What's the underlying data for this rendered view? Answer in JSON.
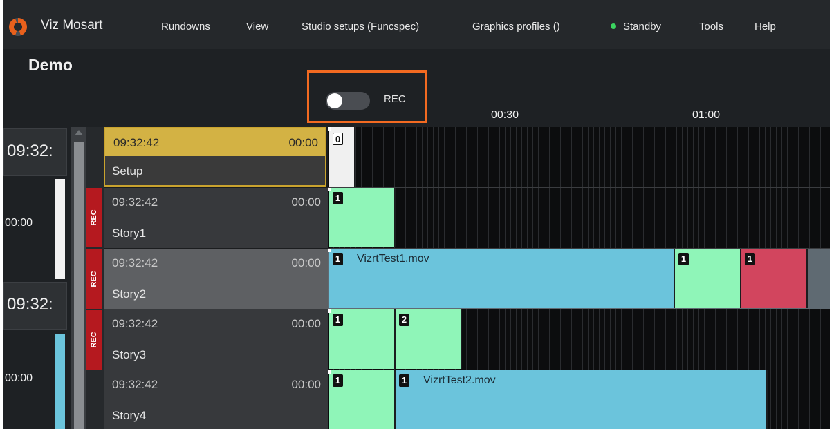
{
  "app": {
    "title": "Viz Mosart",
    "brand_color": "#e8601c",
    "menu": [
      {
        "label": "Rundowns"
      },
      {
        "label": "View"
      },
      {
        "label": "Studio setups (Funcspec)"
      },
      {
        "label": "Graphics profiles ()"
      },
      {
        "label": "Standby",
        "status_color": "#3bd45f"
      },
      {
        "label": "Tools"
      },
      {
        "label": "Help"
      }
    ]
  },
  "header": {
    "title": "Demo",
    "rec_toggle": {
      "label": "REC",
      "on": false,
      "highlight_color": "#f26a21"
    },
    "ticks": [
      "00:30",
      "01:00"
    ]
  },
  "left_column": {
    "clock_top": "09:32:",
    "dur_1": "00:00",
    "clock_mid": "09:32:",
    "dur_2": "00:00"
  },
  "rec_badge_label": "REC",
  "stories": [
    {
      "time": "09:32:42",
      "duration": "00:00",
      "name": "Setup",
      "rec": false,
      "state": "on-air"
    },
    {
      "time": "09:32:42",
      "duration": "00:00",
      "name": "Story1",
      "rec": true,
      "state": "normal"
    },
    {
      "time": "09:32:42",
      "duration": "00:00",
      "name": "Story2",
      "rec": true,
      "state": "selected"
    },
    {
      "time": "09:32:42",
      "duration": "00:00",
      "name": "Story3",
      "rec": true,
      "state": "normal"
    },
    {
      "time": "09:32:42",
      "duration": "00:00",
      "name": "Story4",
      "rec": false,
      "state": "normal"
    }
  ],
  "timeline": {
    "rows": [
      {
        "clips": [
          {
            "num": "0",
            "label": "",
            "color": "#f0f0f0",
            "outlined": true
          }
        ]
      },
      {
        "clips": [
          {
            "num": "1",
            "label": "",
            "color": "#8ff5b8"
          }
        ]
      },
      {
        "clips": [
          {
            "num": "1",
            "label": "VizrtTest1.mov",
            "color": "#6bc4dc"
          },
          {
            "num": "1",
            "label": "",
            "color": "#8ff5b8"
          },
          {
            "num": "1",
            "label": "",
            "color": "#d2455e"
          }
        ]
      },
      {
        "clips": [
          {
            "num": "1",
            "label": "",
            "color": "#8ff5b8"
          },
          {
            "num": "2",
            "label": "",
            "color": "#8ff5b8"
          }
        ]
      },
      {
        "clips": [
          {
            "num": "1",
            "label": "",
            "color": "#8ff5b8"
          },
          {
            "num": "1",
            "label": "VizrtTest2.mov",
            "color": "#6bc4dc"
          }
        ]
      }
    ]
  }
}
